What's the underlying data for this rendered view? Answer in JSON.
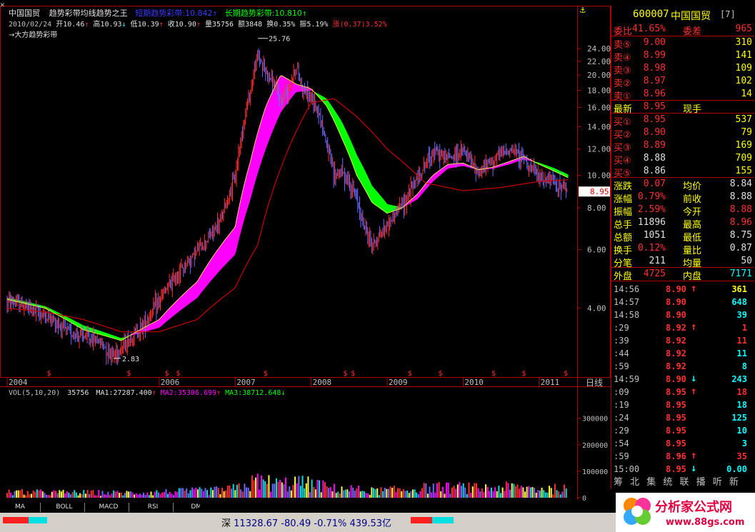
{
  "header": {
    "stock_name": "中国国贸",
    "indicator_name": "趋势彩带均线趋势之王",
    "short_band": "短期趋势彩带:10.842",
    "short_arrow": "↑",
    "long_band": "长期趋势彩带:10.810",
    "long_arrow": "↑",
    "info_date": "2010/02/24",
    "info_open": "开10.46",
    "info_high": "高10.93",
    "info_low": "低10.39",
    "info_close": "收10.90",
    "info_vol": "量35756",
    "info_amt": "额3848",
    "info_turn": "换0.35%",
    "info_amp": "振5.19%",
    "info_chg": "涨(0.37)3.52%",
    "legend_label": "→大方趋势彩带",
    "lock_icon": "⚓"
  },
  "chart_data": {
    "type": "line",
    "title": "中国国贸 趋势彩带均线趋势之王",
    "xlabel": "",
    "ylabel": "",
    "ylim": [
      2.5,
      26.5
    ],
    "log_scale": true,
    "yticks": [
      4.0,
      6.0,
      8.0,
      10.0,
      12.0,
      14.0,
      16.0,
      18.0,
      20.0,
      22.0,
      24.0
    ],
    "ytick_labels": [
      "4.00",
      "6.00",
      "8.00",
      "10.00",
      "12.00",
      "14.00",
      "16.00",
      "18.00",
      "20.00",
      "22.00",
      "24.00"
    ],
    "x_labels": [
      "2004",
      "2006",
      "2007",
      "2008",
      "2009",
      "2010",
      "2011"
    ],
    "x_positions": [
      2004.0,
      2006.0,
      2007.0,
      2008.0,
      2009.0,
      2010.0,
      2011.0
    ],
    "x_range": [
      2004.0,
      2011.5
    ],
    "period_label": "日线",
    "annotations": {
      "high": "25.76",
      "low": "2.83",
      "last_price": "8.95"
    },
    "signal_positions": [
      2004.55,
      2005.6,
      2006.1,
      2006.25,
      2007.4,
      2008.45,
      2008.55,
      2009.3,
      2009.7,
      2010.4,
      2010.8,
      2011.35
    ],
    "signal_label": "$",
    "series": [
      {
        "name": "price",
        "x": [
          2004.0,
          2004.2,
          2004.4,
          2004.6,
          2004.8,
          2005.0,
          2005.2,
          2005.4,
          2005.6,
          2005.8,
          2006.0,
          2006.2,
          2006.4,
          2006.6,
          2006.8,
          2007.0,
          2007.1,
          2007.2,
          2007.3,
          2007.4,
          2007.5,
          2007.6,
          2007.7,
          2007.8,
          2007.9,
          2008.0,
          2008.1,
          2008.2,
          2008.3,
          2008.4,
          2008.5,
          2008.6,
          2008.7,
          2008.8,
          2008.9,
          2009.0,
          2009.2,
          2009.4,
          2009.6,
          2009.8,
          2010.0,
          2010.2,
          2010.4,
          2010.6,
          2010.8,
          2011.0,
          2011.2,
          2011.4
        ],
        "values": [
          4.2,
          4.1,
          3.9,
          3.7,
          3.4,
          3.3,
          3.2,
          2.9,
          3.2,
          3.6,
          4.2,
          4.9,
          5.6,
          6.3,
          7.2,
          9.8,
          14.0,
          18.0,
          23.0,
          20.5,
          19.0,
          16.5,
          18.5,
          21.0,
          18.0,
          17.0,
          15.5,
          12.5,
          10.0,
          10.3,
          9.5,
          8.5,
          7.0,
          6.2,
          6.6,
          7.1,
          8.2,
          9.8,
          11.8,
          11.3,
          11.8,
          10.2,
          11.2,
          12.0,
          11.3,
          9.8,
          9.6,
          8.9
        ]
      },
      {
        "name": "short_band",
        "x": [
          2004.0,
          2004.5,
          2005.0,
          2005.5,
          2006.0,
          2006.5,
          2007.0,
          2007.2,
          2007.4,
          2007.6,
          2007.8,
          2008.0,
          2008.2,
          2008.4,
          2008.6,
          2008.8,
          2009.0,
          2009.2,
          2009.4,
          2009.6,
          2009.8,
          2010.0,
          2010.2,
          2010.4,
          2010.6,
          2010.8,
          2011.0,
          2011.2,
          2011.4
        ],
        "values": [
          4.25,
          4.0,
          3.45,
          3.2,
          3.7,
          4.8,
          7.0,
          11.0,
          16.0,
          20.0,
          18.8,
          18.2,
          16.2,
          13.0,
          10.0,
          8.3,
          7.7,
          8.0,
          8.8,
          10.0,
          10.8,
          10.9,
          10.4,
          10.6,
          11.0,
          11.4,
          10.8,
          10.3,
          9.8
        ]
      },
      {
        "name": "long_band",
        "x": [
          2004.0,
          2004.5,
          2005.0,
          2005.5,
          2006.0,
          2006.5,
          2007.0,
          2007.2,
          2007.4,
          2007.6,
          2007.8,
          2008.0,
          2008.2,
          2008.4,
          2008.6,
          2008.8,
          2009.0,
          2009.2,
          2009.4,
          2009.6,
          2009.8,
          2010.0,
          2010.2,
          2010.4,
          2010.6,
          2010.8,
          2011.0,
          2011.2,
          2011.4
        ],
        "values": [
          4.3,
          4.05,
          3.55,
          3.25,
          3.5,
          4.3,
          5.8,
          8.5,
          12.0,
          15.5,
          17.8,
          18.0,
          17.0,
          14.5,
          11.5,
          9.3,
          8.2,
          8.0,
          8.5,
          9.6,
          10.5,
          10.7,
          10.4,
          10.5,
          10.8,
          11.2,
          10.9,
          10.5,
          10.0
        ]
      },
      {
        "name": "ma_long",
        "x": [
          2004.0,
          2004.5,
          2005.0,
          2005.5,
          2006.0,
          2006.5,
          2007.0,
          2007.3,
          2007.6,
          2008.0,
          2008.3,
          2008.6,
          2009.0,
          2009.5,
          2010.0,
          2010.5,
          2011.0,
          2011.4
        ],
        "values": [
          4.0,
          3.9,
          3.7,
          3.4,
          3.4,
          3.7,
          4.6,
          6.2,
          10.5,
          16.5,
          17.0,
          15.0,
          12.0,
          9.5,
          9.0,
          9.2,
          9.6,
          9.7
        ]
      }
    ]
  },
  "volume": {
    "label": "VOL(5,10,20)",
    "value": "35756",
    "ma1": "MA1:27287.400",
    "ma2": "MA2:35306.699",
    "ma3": "MA3:38712.648",
    "ma1_arrow": "↑",
    "ma2_arrow": "↑",
    "ma3_arrow": "↓",
    "yticks": [
      0,
      100000,
      200000,
      300000
    ],
    "ytick_labels": [
      "0",
      "100000",
      "200000",
      "300000"
    ],
    "ylim": [
      0,
      380000
    ],
    "max_value": 280000
  },
  "tabs": [
    "MA",
    "BOLL",
    "MACD",
    "RSI",
    "DMI"
  ],
  "status": {
    "index_name": "深",
    "index_value": "11328.67",
    "index_change": "-80.49",
    "index_pct": "-0.71%",
    "index_amount": "439.53亿"
  },
  "logo_text": "分析家公式网",
  "logo_url": "www.88gs.com",
  "panel": {
    "code": "600007",
    "name": "中国国贸",
    "badge": "[7]",
    "weibi": {
      "label": "委比",
      "value": "41.65%",
      "label2": "委差",
      "value2": "965"
    },
    "asks": [
      {
        "label": "卖⑤",
        "price": "9.00",
        "vol": "310"
      },
      {
        "label": "卖④",
        "price": "8.99",
        "vol": "141"
      },
      {
        "label": "卖③",
        "price": "8.98",
        "vol": "109"
      },
      {
        "label": "卖②",
        "price": "8.97",
        "vol": "102"
      },
      {
        "label": "卖①",
        "price": "8.96",
        "vol": "14"
      }
    ],
    "latest": {
      "label": "最新",
      "price": "8.95",
      "label2": "现手",
      "vol": ""
    },
    "bids": [
      {
        "label": "买①",
        "price": "8.95",
        "vol": "537"
      },
      {
        "label": "买②",
        "price": "8.90",
        "vol": "79"
      },
      {
        "label": "买③",
        "price": "8.89",
        "vol": "169"
      },
      {
        "label": "买④",
        "price": "8.88",
        "vol": "709"
      },
      {
        "label": "买⑤",
        "price": "8.86",
        "vol": "155"
      }
    ],
    "stats": [
      {
        "l1": "涨跌",
        "v1": "0.07",
        "l2": "均价",
        "v2": "8.84"
      },
      {
        "l1": "涨幅",
        "v1": "0.79%",
        "l2": "前收",
        "v2": "8.88"
      },
      {
        "l1": "振幅",
        "v1": "2.59%",
        "l2": "今开",
        "v2": "8.88"
      },
      {
        "l1": "总手",
        "v1": "11896",
        "l2": "最高",
        "v2": "8.96"
      },
      {
        "l1": "总额",
        "v1": "1051",
        "l2": "最低",
        "v2": "8.75"
      },
      {
        "l1": "换手",
        "v1": "0.12%",
        "l2": "量比",
        "v2": "0.87"
      },
      {
        "l1": "分笔",
        "v1": "211",
        "l2": "均量",
        "v2": "50"
      }
    ],
    "outer": {
      "label": "外盘",
      "value": "4725",
      "label2": "内盘",
      "value2": "7171"
    },
    "ticks": [
      {
        "time": "14:56",
        "price": "8.90",
        "arrow": "↑",
        "vol": "361",
        "pc": "#ff3030",
        "ac": "#ff3030",
        "vc": "#ffff00"
      },
      {
        "time": "14:57",
        "price": "8.90",
        "arrow": "",
        "vol": "648",
        "pc": "#ff3030",
        "ac": "#ff3030",
        "vc": "#00ffff"
      },
      {
        "time": "14:58",
        "price": "8.90",
        "arrow": "",
        "vol": "39",
        "pc": "#ff3030",
        "ac": "#ff3030",
        "vc": "#00ffff"
      },
      {
        "time": ":29",
        "price": "8.92",
        "arrow": "↑",
        "vol": "1",
        "pc": "#ff3030",
        "ac": "#ff3030",
        "vc": "#ff3030"
      },
      {
        "time": ":39",
        "price": "8.92",
        "arrow": "",
        "vol": "11",
        "pc": "#ff3030",
        "ac": "#ff3030",
        "vc": "#ff3030"
      },
      {
        "time": ":44",
        "price": "8.92",
        "arrow": "",
        "vol": "11",
        "pc": "#ff3030",
        "ac": "#ff3030",
        "vc": "#00ffff"
      },
      {
        "time": ":59",
        "price": "8.92",
        "arrow": "",
        "vol": "8",
        "pc": "#ff3030",
        "ac": "#ff3030",
        "vc": "#00ffff"
      },
      {
        "time": "14:59",
        "price": "8.90",
        "arrow": "↓",
        "vol": "243",
        "pc": "#ff3030",
        "ac": "#00ffff",
        "vc": "#00ffff"
      },
      {
        "time": ":09",
        "price": "8.95",
        "arrow": "↑",
        "vol": "18",
        "pc": "#ff3030",
        "ac": "#ff3030",
        "vc": "#ff3030"
      },
      {
        "time": ":19",
        "price": "8.95",
        "arrow": "",
        "vol": "18",
        "pc": "#ff3030",
        "ac": "#ff3030",
        "vc": "#00ffff"
      },
      {
        "time": ":24",
        "price": "8.95",
        "arrow": "",
        "vol": "125",
        "pc": "#ff3030",
        "ac": "#ff3030",
        "vc": "#00ffff"
      },
      {
        "time": ":29",
        "price": "8.95",
        "arrow": "",
        "vol": "10",
        "pc": "#ff3030",
        "ac": "#ff3030",
        "vc": "#00ffff"
      },
      {
        "time": ":54",
        "price": "8.95",
        "arrow": "",
        "vol": "3",
        "pc": "#ff3030",
        "ac": "#ff3030",
        "vc": "#00ffff"
      },
      {
        "time": ":59",
        "price": "8.96",
        "arrow": "↑",
        "vol": "35",
        "pc": "#ff3030",
        "ac": "#ff3030",
        "vc": "#ff3030"
      },
      {
        "time": "15:00",
        "price": "8.95",
        "arrow": "↓",
        "vol": "0.00",
        "pc": "#ff3030",
        "ac": "#00ffff",
        "vc": "#00ffff"
      }
    ],
    "bottom_tabs": "筹 北 集 统 联 播 听 新"
  },
  "colors": {
    "up": "#ff3030",
    "down": "#6b6bff",
    "band_up": "#ff00ff",
    "band_down": "#00ff00",
    "ma_long": "#c00000",
    "ma_yellow": "#ffff40",
    "label_yellow": "#ffff00",
    "cyan": "#00ffff",
    "axis_red": "#b00000"
  }
}
